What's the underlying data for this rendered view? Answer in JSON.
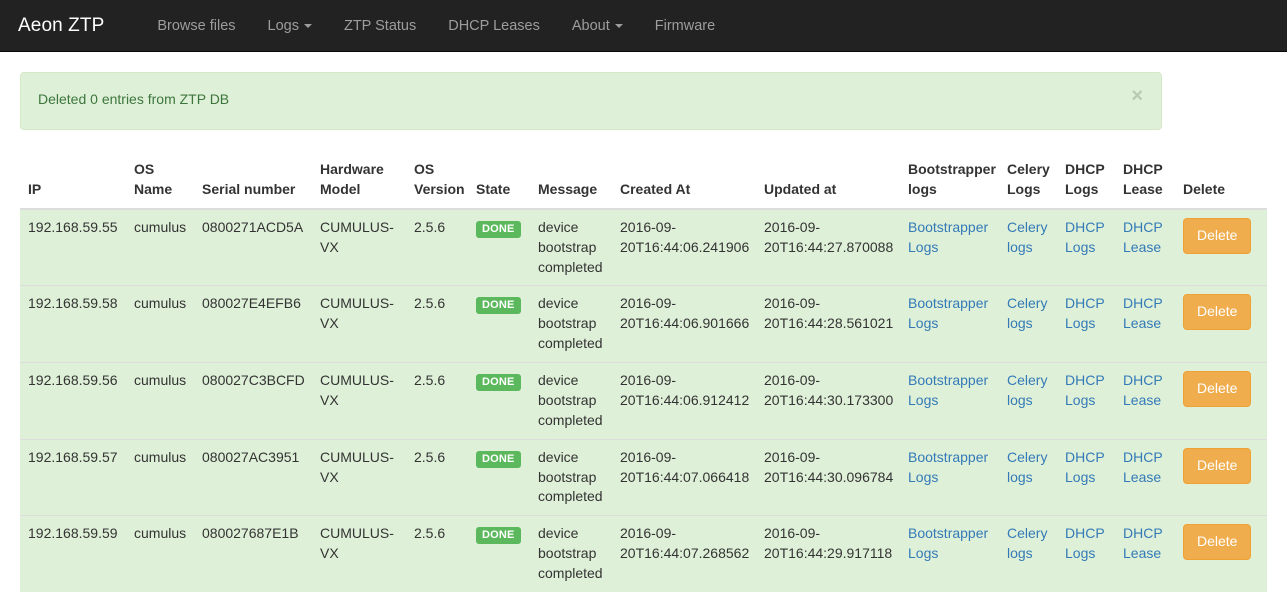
{
  "navbar": {
    "brand": "Aeon ZTP",
    "items": [
      {
        "label": "Browse files",
        "has_caret": false
      },
      {
        "label": "Logs",
        "has_caret": true
      },
      {
        "label": "ZTP Status",
        "has_caret": false
      },
      {
        "label": "DHCP Leases",
        "has_caret": false
      },
      {
        "label": "About",
        "has_caret": true
      },
      {
        "label": "Firmware",
        "has_caret": false
      }
    ],
    "background": "#222222",
    "link_color": "#9d9d9d"
  },
  "alert": {
    "message": "Deleted 0 entries from ZTP DB",
    "close_label": "×",
    "background": "#dff0d8",
    "border": "#d6e9c6",
    "text_color": "#3c763d"
  },
  "table": {
    "headers": [
      "IP",
      "OS Name",
      "Serial number",
      "Hardware Model",
      "OS Version",
      "State",
      "Message",
      "Created At",
      "Updated at",
      "Bootstrapper logs",
      "Celery Logs",
      "DHCP Logs",
      "DHCP Lease",
      "Delete"
    ],
    "link_labels": {
      "bootstrapper": "Bootstrapper Logs",
      "celery": "Celery logs",
      "dhcp_logs": "DHCP Logs",
      "dhcp_lease": "DHCP Lease"
    },
    "delete_label": "Delete",
    "row_background": "#dff0d8",
    "badge_color": "#5cb85c",
    "delete_color": "#f0ad4e",
    "link_color": "#337ab7",
    "rows": [
      {
        "ip": "192.168.59.55",
        "os_name": "cumulus",
        "serial": "0800271ACD5A",
        "hardware_model": "CUMULUS-VX",
        "os_version": "2.5.6",
        "state": "DONE",
        "message": "device bootstrap completed",
        "created_at": "2016-09-20T16:44:06.241906",
        "updated_at": "2016-09-20T16:44:27.870088"
      },
      {
        "ip": "192.168.59.58",
        "os_name": "cumulus",
        "serial": "080027E4EFB6",
        "hardware_model": "CUMULUS-VX",
        "os_version": "2.5.6",
        "state": "DONE",
        "message": "device bootstrap completed",
        "created_at": "2016-09-20T16:44:06.901666",
        "updated_at": "2016-09-20T16:44:28.561021"
      },
      {
        "ip": "192.168.59.56",
        "os_name": "cumulus",
        "serial": "080027C3BCFD",
        "hardware_model": "CUMULUS-VX",
        "os_version": "2.5.6",
        "state": "DONE",
        "message": "device bootstrap completed",
        "created_at": "2016-09-20T16:44:06.912412",
        "updated_at": "2016-09-20T16:44:30.173300"
      },
      {
        "ip": "192.168.59.57",
        "os_name": "cumulus",
        "serial": "080027AC3951",
        "hardware_model": "CUMULUS-VX",
        "os_version": "2.5.6",
        "state": "DONE",
        "message": "device bootstrap completed",
        "created_at": "2016-09-20T16:44:07.066418",
        "updated_at": "2016-09-20T16:44:30.096784"
      },
      {
        "ip": "192.168.59.59",
        "os_name": "cumulus",
        "serial": "080027687E1B",
        "hardware_model": "CUMULUS-VX",
        "os_version": "2.5.6",
        "state": "DONE",
        "message": "device bootstrap completed",
        "created_at": "2016-09-20T16:44:07.268562",
        "updated_at": "2016-09-20T16:44:29.917118"
      }
    ]
  }
}
